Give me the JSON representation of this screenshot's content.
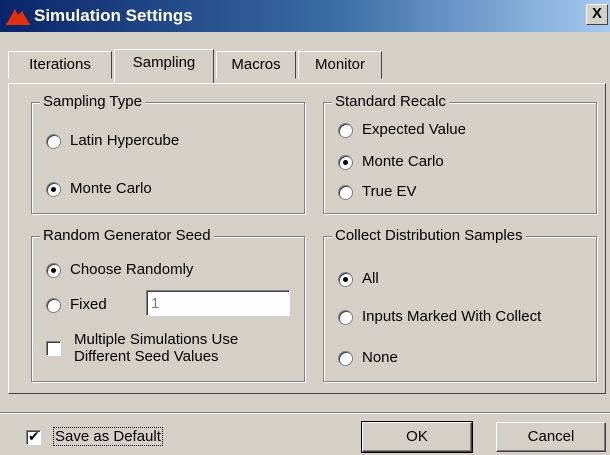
{
  "window": {
    "title": "Simulation Settings",
    "close_label": "X"
  },
  "tabs": [
    {
      "label": "Iterations",
      "active": false
    },
    {
      "label": "Sampling",
      "active": true
    },
    {
      "label": "Macros",
      "active": false
    },
    {
      "label": "Monitor",
      "active": false
    }
  ],
  "sampling_type": {
    "title": "Sampling Type",
    "options": [
      {
        "label": "Latin Hypercube",
        "checked": false
      },
      {
        "label": "Monte Carlo",
        "checked": true
      }
    ]
  },
  "standard_recalc": {
    "title": "Standard Recalc",
    "options": [
      {
        "label": "Expected Value",
        "checked": false
      },
      {
        "label": "Monte Carlo",
        "checked": true
      },
      {
        "label": "True EV",
        "checked": false
      }
    ]
  },
  "random_seed": {
    "title": "Random Generator Seed",
    "choose_randomly_label": "Choose Randomly",
    "choose_randomly_checked": true,
    "fixed_label": "Fixed",
    "fixed_checked": false,
    "fixed_value": "1",
    "multi_sim_label_line1": "Multiple Simulations Use",
    "multi_sim_label_line2": "Different Seed Values",
    "multi_sim_checked": false
  },
  "collect_samples": {
    "title": "Collect Distribution Samples",
    "options": [
      {
        "label": "All",
        "checked": true
      },
      {
        "label": "Inputs Marked With Collect",
        "checked": false
      },
      {
        "label": "None",
        "checked": false
      }
    ]
  },
  "footer": {
    "save_default_label": "Save as Default",
    "save_default_checked": true,
    "ok_label": "OK",
    "cancel_label": "Cancel"
  },
  "colors": {
    "title_bar_start": "#0a246a",
    "title_bar_end": "#a6caf0",
    "face": "#d4d0c8",
    "app_icon": "#e03010"
  }
}
